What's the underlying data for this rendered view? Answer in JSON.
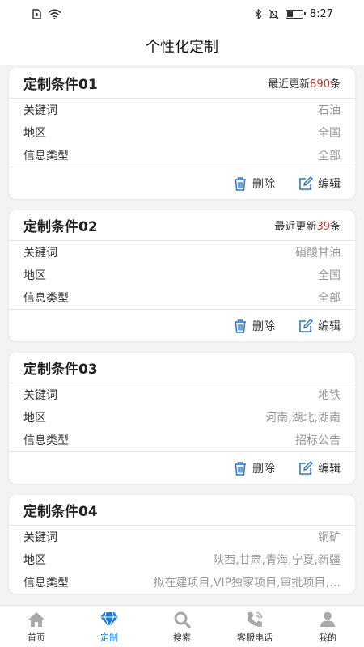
{
  "status_bar": {
    "time": "8:27"
  },
  "header": {
    "title": "个性化定制"
  },
  "labels": {
    "keyword": "关键词",
    "region": "地区",
    "info_type": "信息类型",
    "update_prefix": "最近更新",
    "update_suffix": "条",
    "delete": "删除",
    "edit": "编辑"
  },
  "cards": [
    {
      "title": "定制条件01",
      "update_count": "890",
      "keyword": "石油",
      "region": "全国",
      "info_type": "全部"
    },
    {
      "title": "定制条件02",
      "update_count": "39",
      "keyword": "硝酸甘油",
      "region": "全国",
      "info_type": "全部"
    },
    {
      "title": "定制条件03",
      "keyword": "地铁",
      "region": "河南,湖北,湖南",
      "info_type": "招标公告"
    },
    {
      "title": "定制条件04",
      "keyword": "铜矿",
      "region": "陕西,甘肃,青海,宁夏,新疆",
      "info_type": "拟在建项目,VIP独家项目,审批项目,…"
    }
  ],
  "tabbar": [
    {
      "label": "首页",
      "icon": "home-icon",
      "active": false
    },
    {
      "label": "定制",
      "icon": "diamond-icon",
      "active": true
    },
    {
      "label": "搜索",
      "icon": "search-icon",
      "active": false
    },
    {
      "label": "客服电话",
      "icon": "phone-icon",
      "active": false
    },
    {
      "label": "我的",
      "icon": "user-icon",
      "active": false
    }
  ],
  "colors": {
    "accent": "#1a7bd6",
    "highlight": "#c0392b",
    "icon_gray": "#a8a8a8",
    "action_icon": "#2f7cc9"
  }
}
